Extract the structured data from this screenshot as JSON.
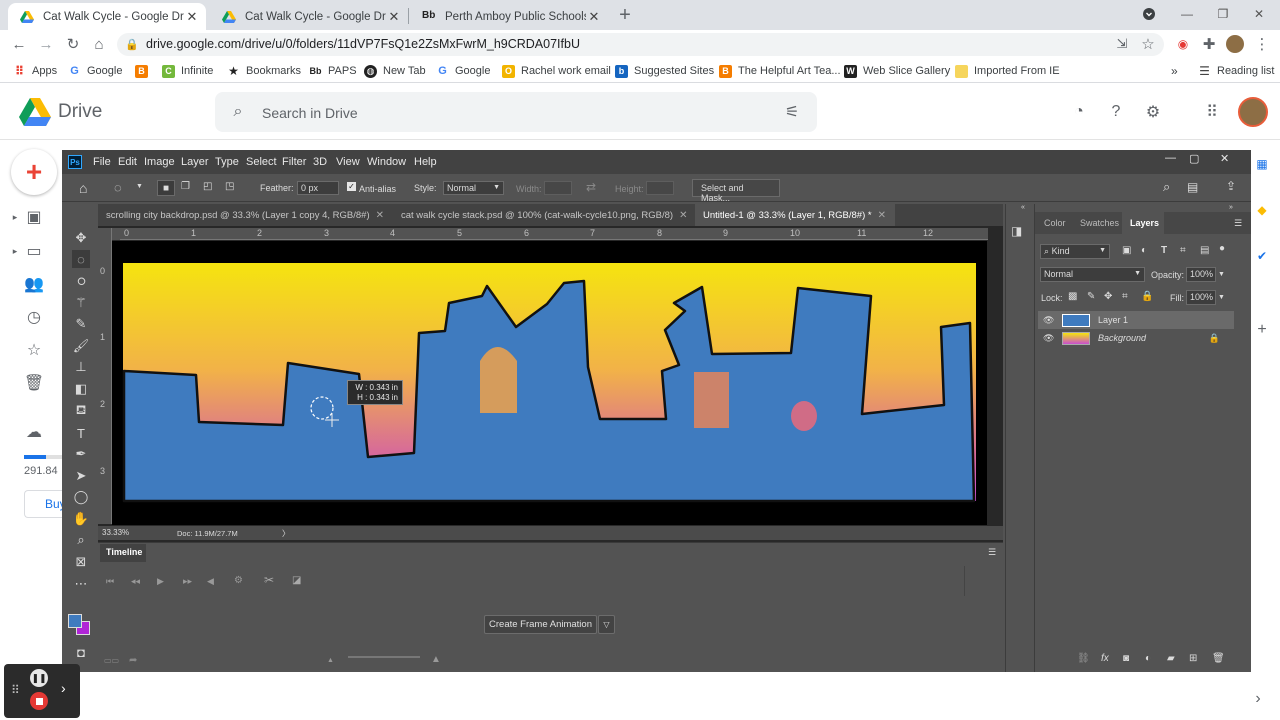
{
  "browser": {
    "tabs": [
      {
        "title": "Cat Walk Cycle - Google Drive",
        "active": true
      },
      {
        "title": "Cat Walk Cycle - Google Drive",
        "active": false
      },
      {
        "title": "Perth Amboy Public Schools / Ho",
        "active": false
      }
    ],
    "new_tab_label": "+",
    "url": "drive.google.com/drive/u/0/folders/11dVP7FsQ1e2ZsMxFwrM_h9CRDA07IfbU",
    "bookmarks": [
      {
        "label": "Apps",
        "icon": "apps-grid-icon"
      },
      {
        "label": "Google",
        "icon": "google-g-icon"
      },
      {
        "label": "Infinite",
        "icon": "infinite-icon"
      },
      {
        "label": "Bookmarks",
        "icon": "star-icon"
      },
      {
        "label": "PAPS",
        "icon": "bb-icon"
      },
      {
        "label": "New Tab",
        "icon": "globe-icon"
      },
      {
        "label": "Google",
        "icon": "google-g-icon"
      },
      {
        "label": "Rachel work email",
        "icon": "mail-icon"
      },
      {
        "label": "Suggested Sites",
        "icon": "suggested-icon"
      },
      {
        "label": "The Helpful Art Tea...",
        "icon": "blogger-icon"
      },
      {
        "label": "Web Slice Gallery",
        "icon": "web-slice-icon"
      },
      {
        "label": "Imported From IE",
        "icon": "folder-icon"
      }
    ],
    "reading_list": "Reading list"
  },
  "drive": {
    "name": "Drive",
    "search_placeholder": "Search in Drive",
    "storage": "291.84",
    "buy_label": "Buy"
  },
  "photoshop": {
    "ps_logo": "Ps",
    "menu": [
      "File",
      "Edit",
      "Image",
      "Layer",
      "Type",
      "Select",
      "Filter",
      "3D",
      "View",
      "Window",
      "Help"
    ],
    "options": {
      "feather_label": "Feather:",
      "feather_value": "0 px",
      "anti_alias": "Anti-alias",
      "style_label": "Style:",
      "style_value": "Normal",
      "width_label": "Width:",
      "height_label": "Height:",
      "select_mask": "Select and Mask..."
    },
    "doc_tabs": [
      {
        "title": "scrolling city backdrop.psd @ 33.3% (Layer 1 copy 4, RGB/8#)",
        "active": false
      },
      {
        "title": "cat walk cycle stack.psd @ 100% (cat-walk-cycle10.png, RGB/8)",
        "active": false
      },
      {
        "title": "Untitled-1 @ 33.3% (Layer 1, RGB/8#) *",
        "active": true
      }
    ],
    "ruler_h": [
      "0",
      "1",
      "2",
      "3",
      "4",
      "5",
      "6",
      "7",
      "8",
      "9",
      "10",
      "11",
      "12"
    ],
    "ruler_v": [
      "0",
      "1",
      "2",
      "3"
    ],
    "tooltip": {
      "w": "W : 0.343 in",
      "h": "H : 0.343 in"
    },
    "zoom": "33.33%",
    "doc_size": "Doc: 11.9M/27.7M",
    "timeline_title": "Timeline",
    "create_frame_animation": "Create Frame Animation",
    "panel_tabs": [
      "Color",
      "Swatches",
      "Layers"
    ],
    "kind_label": "Kind",
    "blend_mode": "Normal",
    "opacity_label": "Opacity:",
    "opacity_value": "100%",
    "lock_label": "Lock:",
    "fill_label": "Fill:",
    "fill_value": "100%",
    "layers": [
      {
        "name": "Layer 1",
        "selected": true
      },
      {
        "name": "Background",
        "selected": false
      }
    ],
    "colors": {
      "sky_top": "#f5e40f",
      "sky_bottom": "#c94fd0",
      "building": "#3f7bbf",
      "foreground_swatch": "#3f7bbf",
      "background_swatch": "#b024d6"
    }
  }
}
